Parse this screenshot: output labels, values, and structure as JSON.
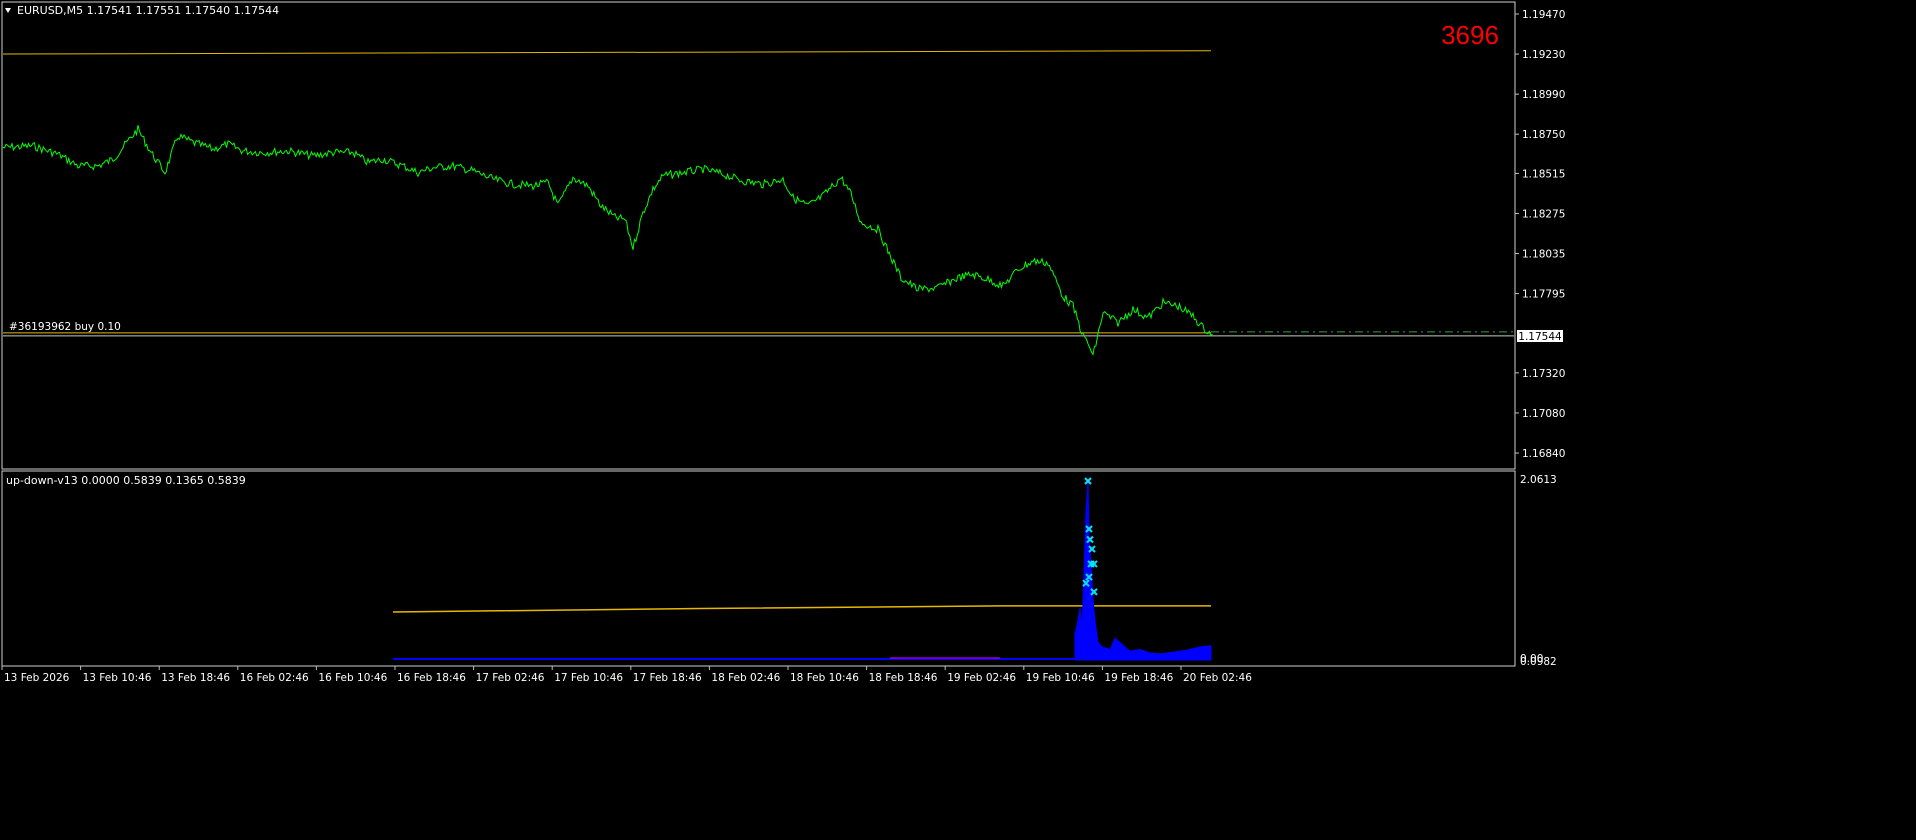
{
  "main": {
    "header": "EURUSD,M5  1.17541 1.17551 1.17540 1.17544",
    "counter": "3696",
    "order_label": "#36193962 buy 0.10",
    "price_ticks": [
      "1.19470",
      "1.19230",
      "1.18990",
      "1.18750",
      "1.18515",
      "1.18275",
      "1.18035",
      "1.17795",
      "1.17320",
      "1.17080",
      "1.16840"
    ],
    "current_price": "1.17544",
    "price_range": [
      1.1675,
      1.1955
    ],
    "price_series": [
      [
        0,
        1.1867
      ],
      [
        30,
        1.1868
      ],
      [
        55,
        1.1863
      ],
      [
        75,
        1.1856
      ],
      [
        95,
        1.1856
      ],
      [
        110,
        1.186
      ],
      [
        135,
        1.1878
      ],
      [
        148,
        1.1864
      ],
      [
        162,
        1.1852
      ],
      [
        175,
        1.1874
      ],
      [
        190,
        1.187
      ],
      [
        210,
        1.1866
      ],
      [
        225,
        1.1869
      ],
      [
        240,
        1.1865
      ],
      [
        260,
        1.1864
      ],
      [
        285,
        1.1865
      ],
      [
        310,
        1.1862
      ],
      [
        330,
        1.1864
      ],
      [
        350,
        1.1864
      ],
      [
        365,
        1.1858
      ],
      [
        380,
        1.186
      ],
      [
        400,
        1.1856
      ],
      [
        415,
        1.1852
      ],
      [
        430,
        1.1855
      ],
      [
        450,
        1.1856
      ],
      [
        470,
        1.1853
      ],
      [
        490,
        1.1848
      ],
      [
        510,
        1.1845
      ],
      [
        530,
        1.1844
      ],
      [
        545,
        1.1846
      ],
      [
        555,
        1.1832
      ],
      [
        570,
        1.1849
      ],
      [
        585,
        1.1844
      ],
      [
        598,
        1.1832
      ],
      [
        612,
        1.1825
      ],
      [
        622,
        1.1824
      ],
      [
        630,
        1.1807
      ],
      [
        640,
        1.1828
      ],
      [
        650,
        1.1842
      ],
      [
        660,
        1.185
      ],
      [
        680,
        1.1852
      ],
      [
        700,
        1.1854
      ],
      [
        720,
        1.1851
      ],
      [
        740,
        1.1847
      ],
      [
        760,
        1.1845
      ],
      [
        780,
        1.1848
      ],
      [
        790,
        1.1837
      ],
      [
        805,
        1.1832
      ],
      [
        820,
        1.1838
      ],
      [
        838,
        1.1849
      ],
      [
        848,
        1.1839
      ],
      [
        858,
        1.1822
      ],
      [
        875,
        1.1818
      ],
      [
        885,
        1.1805
      ],
      [
        898,
        1.1789
      ],
      [
        915,
        1.1782
      ],
      [
        935,
        1.1783
      ],
      [
        955,
        1.1789
      ],
      [
        970,
        1.1791
      ],
      [
        985,
        1.1788
      ],
      [
        1000,
        1.1784
      ],
      [
        1015,
        1.1794
      ],
      [
        1030,
        1.1799
      ],
      [
        1045,
        1.1798
      ],
      [
        1060,
        1.1778
      ],
      [
        1070,
        1.1772
      ],
      [
        1080,
        1.1754
      ],
      [
        1085,
        1.175
      ],
      [
        1090,
        1.1742
      ],
      [
        1100,
        1.1768
      ],
      [
        1115,
        1.1762
      ],
      [
        1130,
        1.177
      ],
      [
        1145,
        1.1765
      ],
      [
        1160,
        1.1774
      ],
      [
        1175,
        1.1772
      ],
      [
        1190,
        1.1766
      ],
      [
        1200,
        1.1759
      ],
      [
        1211,
        1.17544
      ]
    ],
    "upper_line": [
      [
        0,
        1.1923
      ],
      [
        1211,
        1.1925
      ]
    ],
    "order_line_price": 1.1756,
    "dates": [
      "13 Feb 2026",
      "13 Feb 10:46",
      "13 Feb 18:46",
      "16 Feb 02:46",
      "16 Feb 10:46",
      "16 Feb 18:46",
      "17 Feb 02:46",
      "17 Feb 10:46",
      "17 Feb 18:46",
      "18 Feb 02:46",
      "18 Feb 10:46",
      "18 Feb 18:46",
      "19 Feb 02:46",
      "19 Feb 10:46",
      "19 Feb 18:46",
      "20 Feb 02:46"
    ]
  },
  "indicator": {
    "header": "up-down-v13 0.0000 0.5839 0.1365 0.5839",
    "ticks": [
      "2.0613",
      "0.0982"
    ],
    "zero_label": "0.00",
    "range": [
      0,
      2.0613
    ],
    "yellow_line": [
      [
        393,
        0.55
      ],
      [
        700,
        0.59
      ],
      [
        1000,
        0.62
      ],
      [
        1211,
        0.62
      ]
    ],
    "blue_bars": [
      [
        1075,
        0.3
      ],
      [
        1078,
        0.45
      ],
      [
        1080,
        0.6
      ],
      [
        1082,
        0.35
      ],
      [
        1084,
        1.0
      ],
      [
        1086,
        1.7
      ],
      [
        1088,
        2.05
      ],
      [
        1089,
        1.4
      ],
      [
        1091,
        1.1
      ],
      [
        1093,
        0.7
      ],
      [
        1095,
        0.45
      ],
      [
        1098,
        0.2
      ],
      [
        1102,
        0.15
      ],
      [
        1110,
        0.12
      ],
      [
        1115,
        0.25
      ],
      [
        1130,
        0.1
      ],
      [
        1140,
        0.12
      ],
      [
        1150,
        0.08
      ],
      [
        1160,
        0.07
      ],
      [
        1180,
        0.1
      ],
      [
        1190,
        0.12
      ],
      [
        1200,
        0.15
      ],
      [
        1208,
        0.16
      ],
      [
        1211,
        0.16
      ]
    ],
    "markers": [
      [
        1088,
        2.05
      ],
      [
        1089,
        1.5
      ],
      [
        1090,
        1.38
      ],
      [
        1092,
        1.27
      ],
      [
        1091,
        1.1
      ],
      [
        1094,
        1.1
      ],
      [
        1089,
        0.95
      ],
      [
        1086,
        0.88
      ],
      [
        1094,
        0.78
      ]
    ]
  },
  "colors": {
    "bg": "#000000",
    "axis": "#c0c0c0",
    "price": "#00ff00",
    "gold": "#e6b800",
    "counter": "#ff0000",
    "blue": "#0000ff",
    "marker": "#00e5ff",
    "magenta": "#9b00b4",
    "frame": "#d0d0d0"
  }
}
